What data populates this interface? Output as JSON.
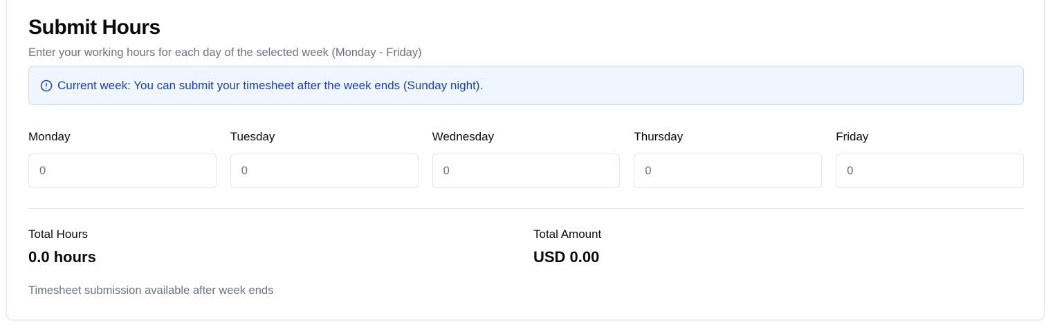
{
  "header": {
    "title": "Submit Hours",
    "subtitle": "Enter your working hours for each day of the selected week (Monday - Friday)"
  },
  "alert": {
    "icon": "info-circle-icon",
    "text": "Current week: You can submit your timesheet after the week ends (Sunday night).",
    "colors": {
      "background": "#eff6ff",
      "border": "#bfdbfe",
      "text": "#1e40af"
    }
  },
  "days": [
    {
      "label": "Monday",
      "placeholder": "0"
    },
    {
      "label": "Tuesday",
      "placeholder": "0"
    },
    {
      "label": "Wednesday",
      "placeholder": "0"
    },
    {
      "label": "Thursday",
      "placeholder": "0"
    },
    {
      "label": "Friday",
      "placeholder": "0"
    }
  ],
  "totals": {
    "hours_label": "Total Hours",
    "hours_value": "0.0 hours",
    "amount_label": "Total Amount",
    "amount_value": "USD 0.00"
  },
  "footer": {
    "note": "Timesheet submission available after week ends"
  }
}
